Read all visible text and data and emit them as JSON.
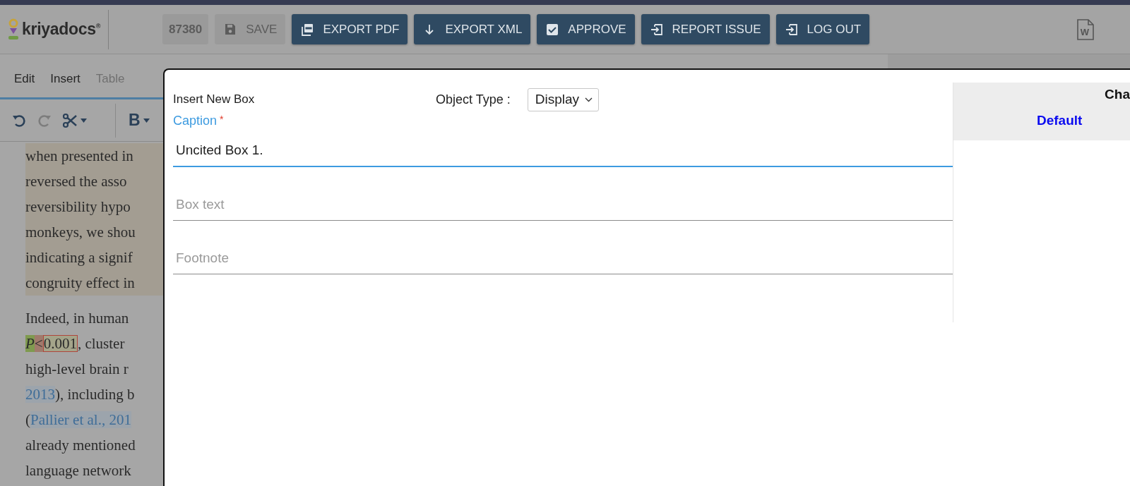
{
  "header": {
    "logo": "kriyadocs$^{®}$",
    "buttons": [
      {
        "label": "87380",
        "kind": "id",
        "disabled": true
      },
      {
        "label": "SAVE",
        "kind": "save",
        "disabled": true
      },
      {
        "label": "EXPORT PDF",
        "kind": "pdf",
        "disabled": false
      },
      {
        "label": "EXPORT XML",
        "kind": "download",
        "disabled": false
      },
      {
        "label": "APPROVE",
        "kind": "check",
        "disabled": false
      },
      {
        "label": "REPORT ISSUE",
        "kind": "exit",
        "disabled": false
      },
      {
        "label": "LOG OUT",
        "kind": "exit",
        "disabled": false
      }
    ],
    "word_icon_label": "W"
  },
  "menu": [
    {
      "label": "Edit",
      "disabled": false
    },
    {
      "label": "Insert",
      "disabled": false
    },
    {
      "label": "Table",
      "disabled": true
    }
  ],
  "toolbar": [
    {
      "kind": "undo",
      "disabled": false
    },
    {
      "kind": "redo",
      "disabled": true
    },
    {
      "kind": "cut",
      "disabled": false
    },
    {
      "kind": "bold",
      "label": "B",
      "disabled": false
    }
  ],
  "document": {
    "paragraphs": [
      {
        "highlighted": true,
        "lines": [
          [
            {
              "text": "when presented in",
              "kind": "text"
            }
          ],
          [
            {
              "text": "reversed the asso",
              "kind": "text"
            }
          ],
          [
            {
              "text": "reversibility hypo",
              "kind": "text"
            }
          ],
          [
            {
              "text": "monkeys, we shou",
              "kind": "text"
            }
          ],
          [
            {
              "text": "indicating a signif",
              "kind": "text"
            }
          ],
          [
            {
              "text": "congruity effect in",
              "kind": "text"
            }
          ]
        ]
      },
      {
        "highlighted": false,
        "lines": [
          [
            {
              "text": "Indeed, in human",
              "kind": "text"
            }
          ],
          [
            {
              "text": "P",
              "kind": "variable"
            },
            {
              "text": "<",
              "kind": "operator"
            },
            {
              "text": "0.001",
              "kind": "value"
            },
            {
              "text": ", cluster",
              "kind": "text"
            }
          ],
          [
            {
              "text": "high-level brain r",
              "kind": "text"
            }
          ],
          [
            {
              "text": "2013",
              "kind": "link"
            },
            {
              "text": "), including b",
              "kind": "text"
            }
          ],
          [
            {
              "text": "(",
              "kind": "text"
            },
            {
              "text": "Pallier et al., 201",
              "kind": "link"
            }
          ],
          [
            {
              "text": "already mentioned",
              "kind": "text"
            }
          ],
          [
            {
              "text": "language network",
              "kind": "text"
            }
          ]
        ]
      }
    ]
  },
  "modal": {
    "title": "Insert New Box",
    "object_type": {
      "label": "Object Type :",
      "value": "Display"
    },
    "fields": [
      {
        "label": "Caption",
        "required": true,
        "required_mark": "*",
        "value": "Uncited Box 1.",
        "focused": true
      },
      {
        "placeholder": "Box text",
        "focused": false
      },
      {
        "placeholder": "Footnote",
        "focused": false
      }
    ],
    "side_panel": {
      "heading": "Cha",
      "option": "Default"
    }
  }
}
